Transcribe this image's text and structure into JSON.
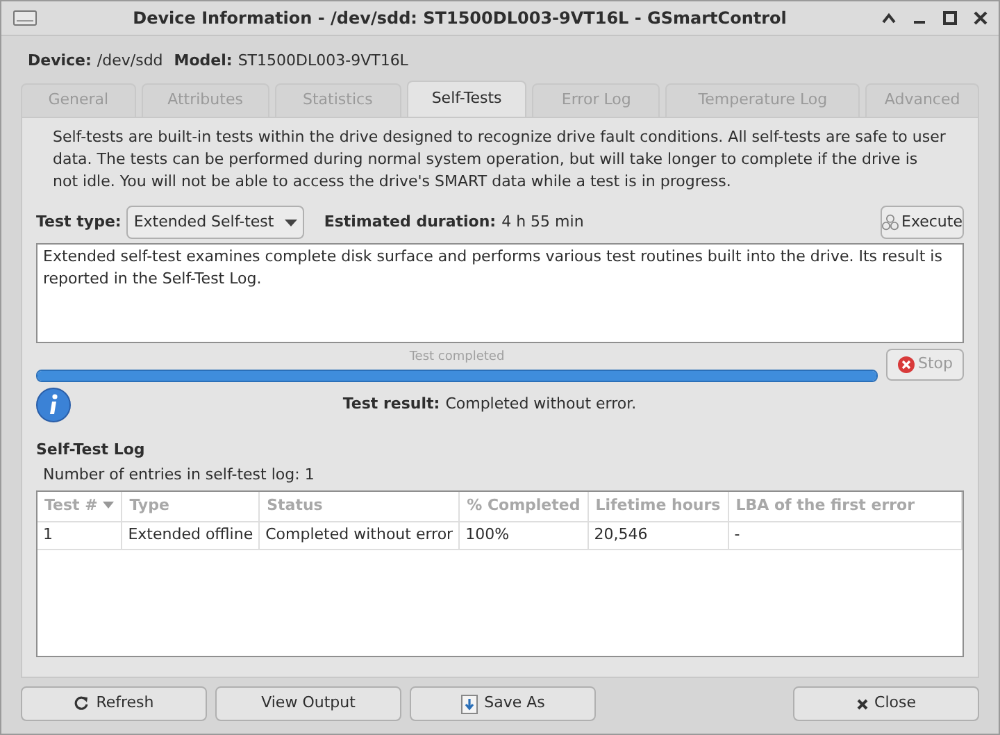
{
  "window": {
    "title": "Device Information - /dev/sdd: ST1500DL003-9VT16L - GSmartControl"
  },
  "device_line": {
    "device_label": "Device:",
    "device": "/dev/sdd",
    "model_label": "Model:",
    "model": "ST1500DL003-9VT16L"
  },
  "tabs": [
    {
      "label": "General",
      "selected": false
    },
    {
      "label": "Attributes",
      "selected": false
    },
    {
      "label": "Statistics",
      "selected": false
    },
    {
      "label": "Self-Tests",
      "selected": true
    },
    {
      "label": "Error Log",
      "selected": false
    },
    {
      "label": "Temperature Log",
      "selected": false
    },
    {
      "label": "Advanced",
      "selected": false
    }
  ],
  "intro": "Self-tests are built-in tests within the drive designed to recognize drive fault conditions. All self-tests are safe to user data. The tests can be performed during normal system operation, but will take longer to complete if the drive is not idle. You will not be able to access the drive's SMART data while a test is in progress.",
  "test_type": {
    "label": "Test type:",
    "value": "Extended Self-test"
  },
  "duration": {
    "label": "Estimated duration:",
    "value": "4 h 55 min"
  },
  "execute_button": {
    "label": "Execute",
    "disabled": false
  },
  "description": "Extended self-test examines complete disk surface and performs various test routines built into the drive. Its result is reported in the Self-Test Log.",
  "progress": {
    "label": "Test completed",
    "level": 1
  },
  "stop_button": {
    "label": "Stop",
    "disabled": true
  },
  "result": {
    "label": "Test result:",
    "value": "Completed without error."
  },
  "log": {
    "title": "Self-Test Log",
    "count": "Number of entries in self-test log: 1",
    "columns": [
      "Test #",
      "Type",
      "Status",
      "% Completed",
      "Lifetime hours",
      "LBA of the first error"
    ],
    "rows": [
      [
        "1",
        "Extended offline",
        "Completed without error",
        "100%",
        "20,546",
        "-"
      ]
    ]
  },
  "buttons": [
    {
      "kind": "refresh",
      "label": "Refresh"
    },
    {
      "kind": "plain",
      "label": "View Output"
    },
    {
      "kind": "save",
      "label": "Save As"
    },
    {
      "kind": "close",
      "label": "Close"
    }
  ]
}
